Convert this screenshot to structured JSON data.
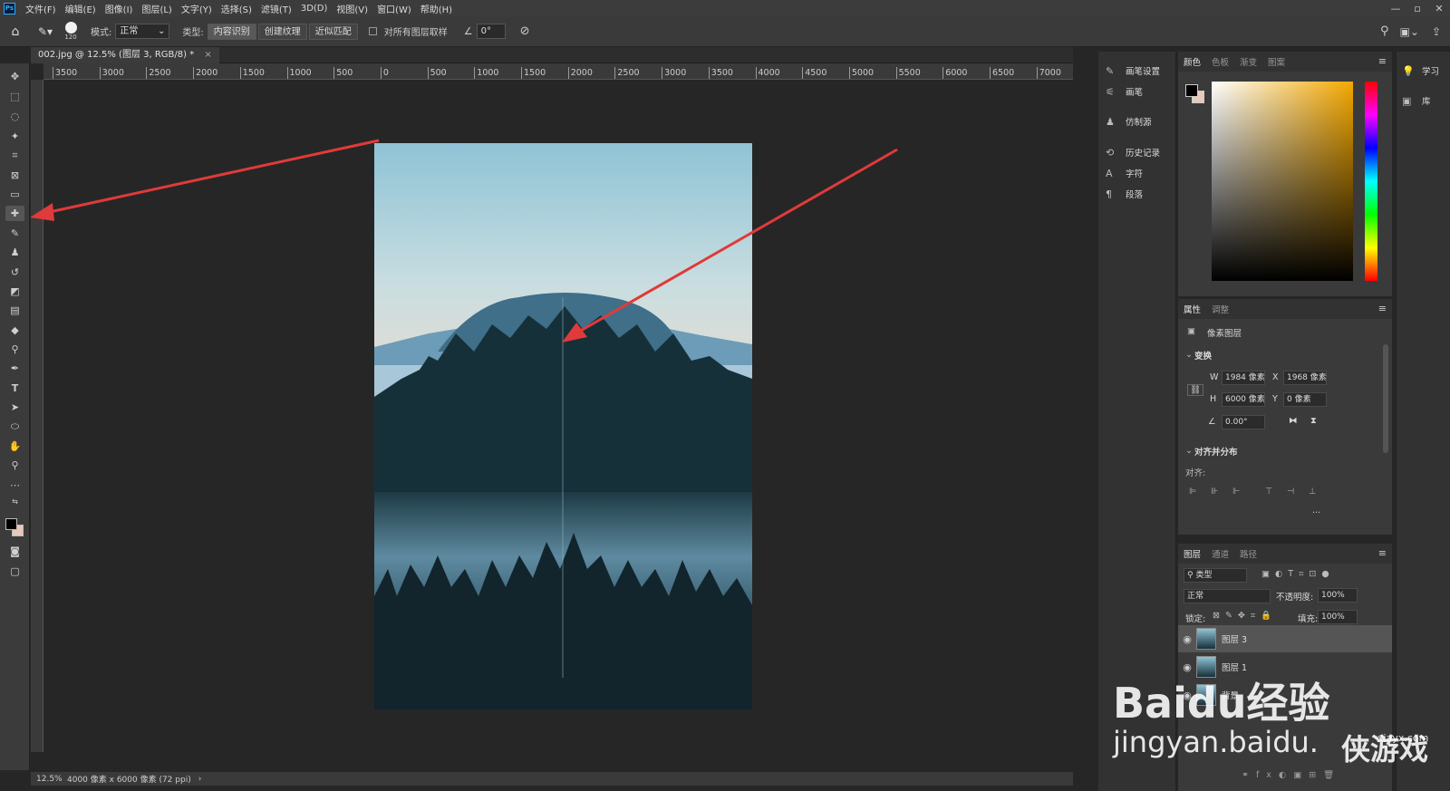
{
  "menubar": {
    "logo": "Ps",
    "items": [
      "文件(F)",
      "编辑(E)",
      "图像(I)",
      "图层(L)",
      "文字(Y)",
      "选择(S)",
      "滤镜(T)",
      "3D(D)",
      "视图(V)",
      "窗口(W)",
      "帮助(H)"
    ],
    "window_buttons": [
      "—",
      "▫",
      "✕"
    ]
  },
  "options_bar": {
    "brush_size": "120",
    "mode_label": "模式:",
    "mode_value": "正常",
    "type_label": "类型:",
    "type_buttons": [
      "内容识别",
      "创建纹理",
      "近似匹配"
    ],
    "sample_all_label": "对所有图层取样",
    "angle_value": "0°"
  },
  "document": {
    "tab_title": "002.jpg @ 12.5% (图层 3, RGB/8) *",
    "ruler_ticks": [
      "3500",
      "3000",
      "2500",
      "2000",
      "1500",
      "1000",
      "500",
      "0",
      "500",
      "1000",
      "1500",
      "2000",
      "2500",
      "3000",
      "3500",
      "4000",
      "4500",
      "5000",
      "5500",
      "6000",
      "6500",
      "7000"
    ]
  },
  "statusbar": {
    "zoom": "12.5%",
    "doc_info": "4000 像素 x 6000 像素 (72 ppi)",
    "arrow": "›"
  },
  "panel_list": {
    "items": [
      "画笔设置",
      "画笔",
      "仿制源",
      "历史记录",
      "字符",
      "段落"
    ]
  },
  "color_panel": {
    "tabs": [
      "颜色",
      "色板",
      "渐变",
      "图案"
    ]
  },
  "properties_panel": {
    "tabs": [
      "属性",
      "调整"
    ],
    "layer_type": "像素图层",
    "transform_heading": "变换",
    "w_label": "W",
    "w_value": "1984 像素",
    "x_label": "X",
    "x_value": "1968 像素",
    "h_label": "H",
    "h_value": "6000 像素",
    "y_label": "Y",
    "y_value": "0 像素",
    "angle_value": "0.00°",
    "align_heading": "对齐并分布",
    "align_label": "对齐:",
    "more": "..."
  },
  "layers_panel": {
    "tabs": [
      "图层",
      "通道",
      "路径"
    ],
    "filter_kind": "类型",
    "blend_mode": "正常",
    "opacity_label": "不透明度:",
    "opacity_value": "100%",
    "lock_label": "锁定:",
    "fill_label": "填充:",
    "fill_value": "100%",
    "layers": [
      {
        "name": "图层 3"
      },
      {
        "name": "图层 1"
      },
      {
        "name": "背景"
      }
    ]
  },
  "right_col": {
    "learn": "学习",
    "library": "库"
  },
  "watermark": {
    "text1": "Baidu经验",
    "text2": "jingyan.baidu.",
    "text3": "侠游戏",
    "text4": "xiayx.com"
  },
  "colors": {
    "arrow_red": "#e03a3a",
    "foreground": "#000000",
    "background": "#e8c8b8"
  }
}
